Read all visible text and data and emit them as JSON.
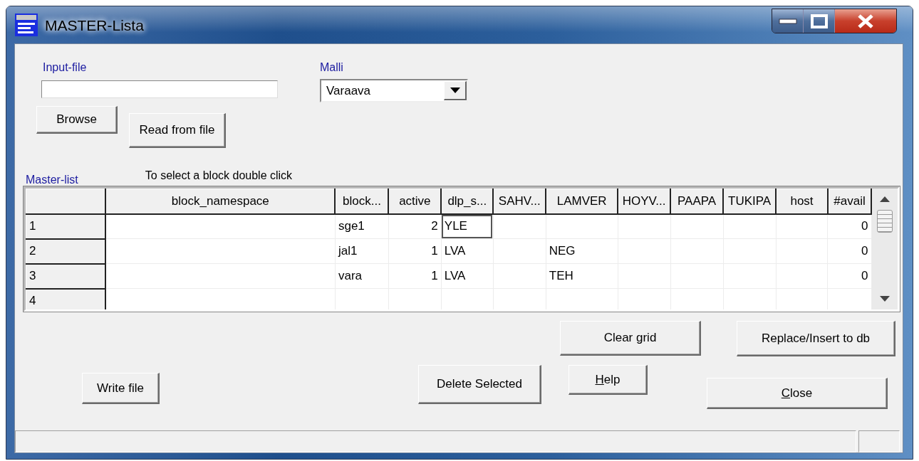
{
  "window": {
    "title": "MASTER-Lista"
  },
  "input_file": {
    "label": "Input-file"
  },
  "model": {
    "label": "Malli",
    "value": "Varaava"
  },
  "top_buttons": [
    {
      "label": "Browse"
    },
    {
      "label": "Read from file"
    }
  ],
  "master_list": {
    "label": "Master-list",
    "hint": "To select a block double click"
  },
  "table": {
    "columns": [
      {
        "label": "block_namespace",
        "kind": "text"
      },
      {
        "label": "block...",
        "kind": "text"
      },
      {
        "label": "active",
        "kind": "number"
      },
      {
        "label": "dlp_s...",
        "kind": "text"
      },
      {
        "label": "SAHV...",
        "kind": "text"
      },
      {
        "label": "LAMVER",
        "kind": "text"
      },
      {
        "label": "HOYV...",
        "kind": "text"
      },
      {
        "label": "PAAPA",
        "kind": "text"
      },
      {
        "label": "TUKIPA",
        "kind": "text"
      },
      {
        "label": "host",
        "kind": "text"
      },
      {
        "label": "#avail",
        "kind": "number"
      }
    ],
    "rows": [
      {
        "header": "1",
        "cells": [
          {
            "focused": false
          },
          {
            "text": "sge1",
            "focused": false
          },
          {
            "text": "2",
            "focused": false
          },
          {
            "text": "YLE",
            "focused": true
          },
          {
            "focused": false
          },
          {
            "focused": false
          },
          {
            "focused": false
          },
          {
            "focused": false
          },
          {
            "focused": false
          },
          {
            "focused": false
          },
          {
            "text": "0",
            "focused": false
          }
        ]
      },
      {
        "header": "2",
        "cells": [
          {
            "focused": false
          },
          {
            "text": "jal1",
            "focused": false
          },
          {
            "text": "1",
            "focused": false
          },
          {
            "text": "LVA",
            "focused": false
          },
          {
            "focused": false
          },
          {
            "text": "NEG",
            "focused": false
          },
          {
            "focused": false
          },
          {
            "focused": false
          },
          {
            "focused": false
          },
          {
            "focused": false
          },
          {
            "text": "0",
            "focused": false
          }
        ]
      },
      {
        "header": "3",
        "cells": [
          {
            "focused": false
          },
          {
            "text": "vara",
            "focused": false
          },
          {
            "text": "1",
            "focused": false
          },
          {
            "text": "LVA",
            "focused": false
          },
          {
            "focused": false
          },
          {
            "text": "TEH",
            "focused": false
          },
          {
            "focused": false
          },
          {
            "focused": false
          },
          {
            "focused": false
          },
          {
            "focused": false
          },
          {
            "text": "0",
            "focused": false
          }
        ]
      },
      {
        "header": "4",
        "cells": [
          {
            "focused": false
          },
          {
            "focused": false
          },
          {
            "focused": false
          },
          {
            "focused": false
          },
          {
            "focused": false
          },
          {
            "focused": false
          },
          {
            "focused": false
          },
          {
            "focused": false
          },
          {
            "focused": false
          },
          {
            "focused": false
          },
          {
            "focused": false
          }
        ]
      }
    ]
  },
  "bottom_buttons": {
    "write_file": {
      "label": "Write file"
    },
    "delete_selected": {
      "label": "Delete Selected"
    },
    "clear_grid": {
      "label": "Clear grid"
    },
    "help": {
      "mnemonic": "H",
      "rest": "elp"
    },
    "replace_insert": {
      "label": "Replace/Insert to db"
    },
    "close": {
      "mnemonic": "C",
      "rest": "lose"
    }
  }
}
